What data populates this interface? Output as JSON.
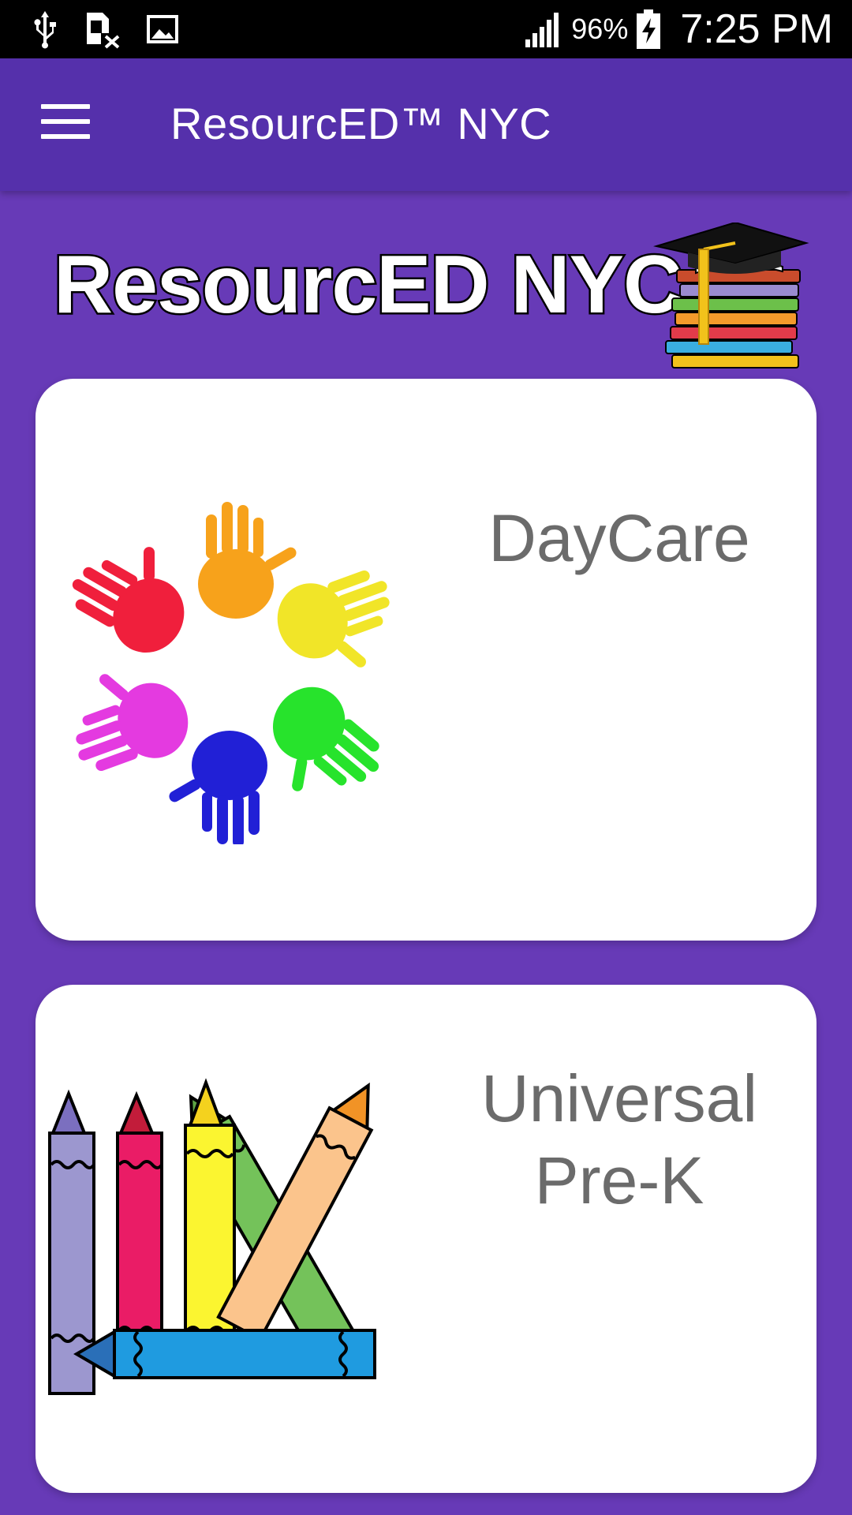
{
  "status_bar": {
    "battery_percent": "96%",
    "time": "7:25 PM"
  },
  "app_bar": {
    "title": "ResourcED™ NYC"
  },
  "banner": {
    "logo_text": "ResourcED NYC"
  },
  "cards": [
    {
      "label": "DayCare",
      "icon": "handprints-illustration"
    },
    {
      "label": "Universal Pre-K",
      "icon": "crayons-illustration"
    }
  ],
  "colors": {
    "background": "#673ab7",
    "app_bar": "#5530ab",
    "card": "#ffffff",
    "card_text": "#6b6b6b"
  }
}
